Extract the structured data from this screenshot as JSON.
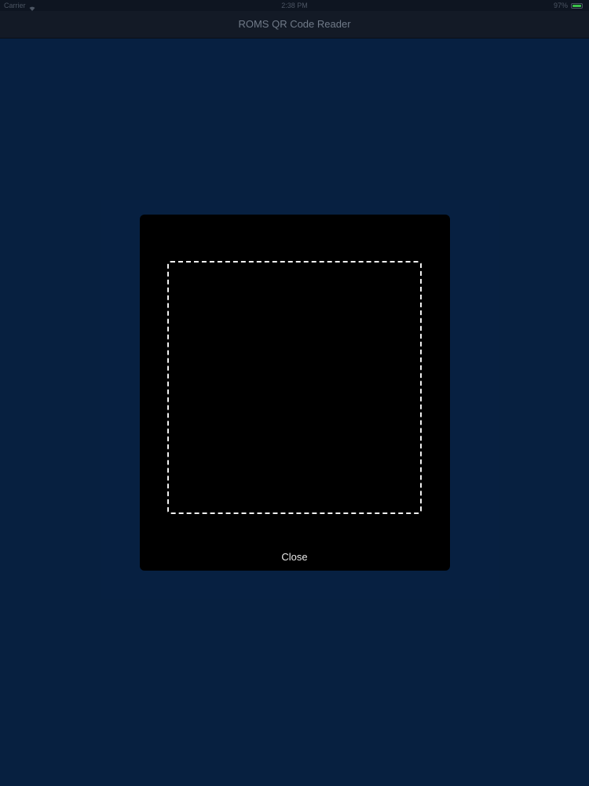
{
  "status_bar": {
    "carrier": "Carrier",
    "time": "2:38 PM",
    "battery": "97%",
    "battery_level": 0.97,
    "battery_color": "#3cc24a"
  },
  "nav": {
    "title": "ROMS QR Code Reader"
  },
  "scanner": {
    "close_label": "Close"
  },
  "colors": {
    "background": "#082448",
    "nav_background": "#131a26",
    "modal_background": "#000000",
    "frame_stroke": "#f2f2f2"
  },
  "icons": {
    "wifi": "wifi-icon",
    "battery": "battery-icon"
  }
}
